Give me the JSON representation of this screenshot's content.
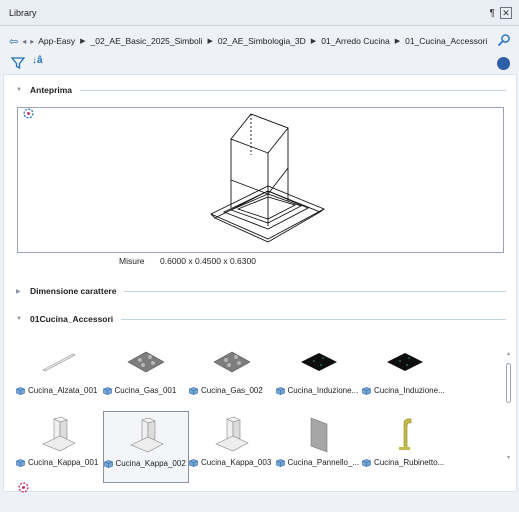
{
  "titlebar": {
    "title": "Library",
    "pin": "¶",
    "close": "✕"
  },
  "navbar": {
    "back": "⇦",
    "small1": "◂",
    "small2": "▸",
    "crumbs": [
      "App-Easy",
      "_02_AE_Basic_2025_Simboli",
      "02_AE_Simbologia_3D",
      "01_Arredo Cucina",
      "01_Cucina_Accessori"
    ],
    "separator": "▶",
    "search_icon": "search-icon"
  },
  "toolbar": {
    "filter_icon": "filter-icon",
    "sort_label": "↓â",
    "globe_icon": "globe-icon"
  },
  "sections": {
    "preview": "Anteprima",
    "dimension": "Dimensione carattere",
    "folder": "01Cucina_Accessori"
  },
  "dimensions": {
    "label": "Misure",
    "value": "0.6000 x 0.4500 x 0.6300"
  },
  "items": [
    {
      "label": "Cucina_Alzata_001",
      "thumb": "alzata"
    },
    {
      "label": "Cucina_Gas_001",
      "thumb": "gas"
    },
    {
      "label": "Cucina_Gas_002",
      "thumb": "gas"
    },
    {
      "label": "Cucina_Induzione...",
      "thumb": "induzione"
    },
    {
      "label": "Cucina_Induzione...",
      "thumb": "induzione"
    },
    {
      "label": "Cucina_Kappa_001",
      "thumb": "kappa"
    },
    {
      "label": "Cucina_Kappa_002",
      "thumb": "kappa",
      "selected": true
    },
    {
      "label": "Cucina_Kappa_003",
      "thumb": "kappa"
    },
    {
      "label": "Cucina_Pannello_...",
      "thumb": "pannello"
    },
    {
      "label": "Cucina_Rubinetto...",
      "thumb": "rubinetto"
    }
  ],
  "colors": {
    "accent": "#1f6fbf",
    "panel": "#ffffff",
    "background": "#eef1f6"
  }
}
